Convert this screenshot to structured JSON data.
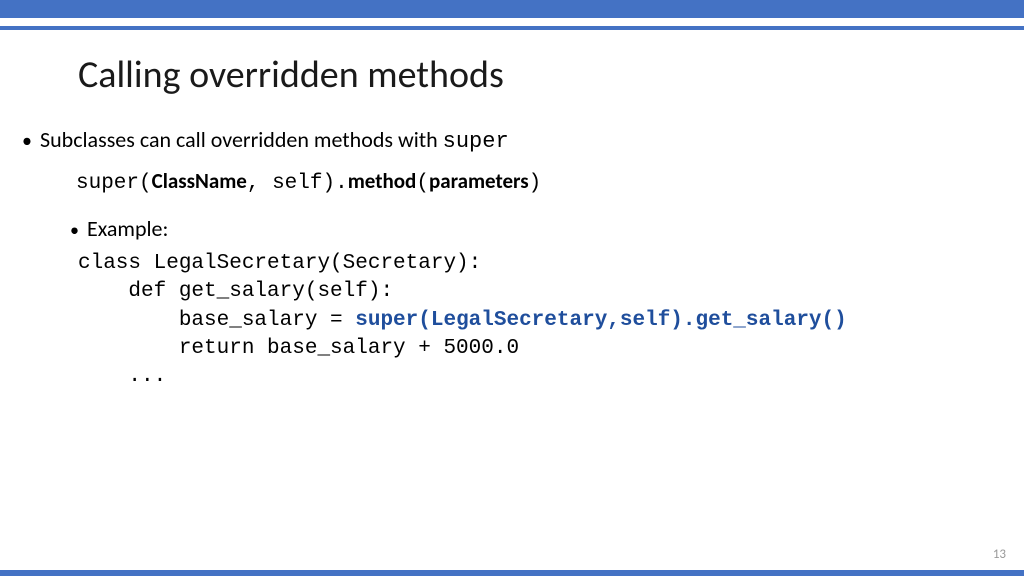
{
  "title": "Calling overridden methods",
  "bullet1": {
    "text_prefix": "Subclasses can call overridden methods with ",
    "keyword": "super"
  },
  "syntax": {
    "p1": "super(",
    "class": "ClassName",
    "p2": ", self).",
    "method": "method",
    "p3": "(",
    "params": "parameters",
    "p4": ")"
  },
  "bullet2": "Example:",
  "code": {
    "l1": "class LegalSecretary(Secretary):",
    "l2": "    def get_salary(self):",
    "l3a": "        base_salary = ",
    "l3b": "super(LegalSecretary,self).get_salary()",
    "l4": "        return base_salary + 5000.0",
    "l5": "    ..."
  },
  "page_number": "13"
}
